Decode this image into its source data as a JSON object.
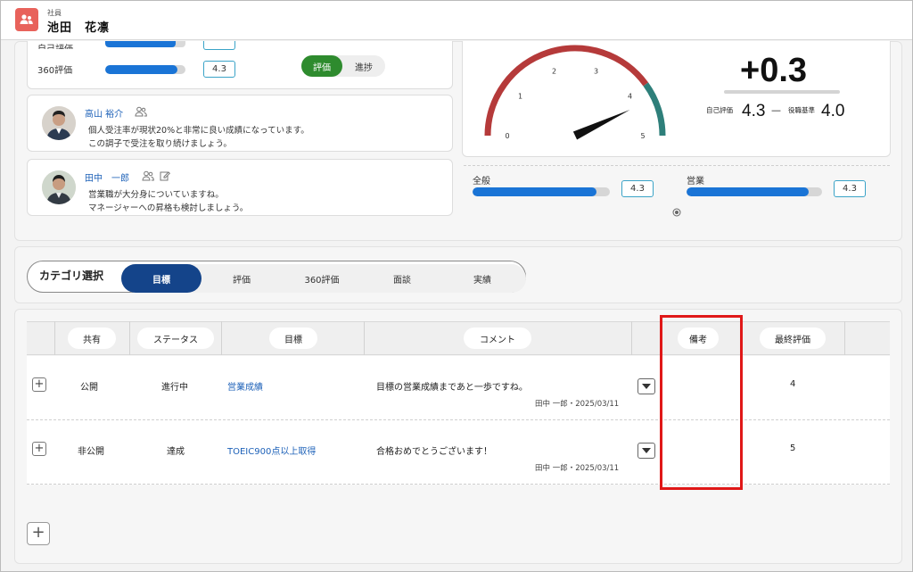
{
  "header": {
    "label": "社員",
    "name": "池田　花凛"
  },
  "scores": {
    "partial_label": "自己評価",
    "row_360_label": "360評価",
    "row_360_value": "4.3",
    "row_360_progress": 0.9,
    "toggle": {
      "active": "評価",
      "inactive": "進捗"
    }
  },
  "comments": [
    {
      "name": "高山 裕介",
      "lines": [
        "個人受注率が現状20%と非常に良い成績になっています。",
        "この調子で受注を取り続けましょう。"
      ]
    },
    {
      "name": "田中　一郎",
      "lines": [
        "営業職が大分身についていますね。",
        "マネージャーへの昇格も検討しましょう。"
      ]
    }
  ],
  "gauge": {
    "ticks": [
      "0",
      "1",
      "2",
      "3",
      "4",
      "5"
    ],
    "value": 4.3,
    "delta": "+0.3",
    "self_label": "自己評価",
    "self_value": "4.3",
    "dash": "—",
    "role_label": "役職基準",
    "role_value": "4.0",
    "colors": {
      "low": "#b53a3a",
      "high": "#2e7f7a"
    }
  },
  "sub_scores": [
    {
      "label": "全般",
      "value": "4.3",
      "progress": 0.9
    },
    {
      "label": "営業",
      "value": "4.3",
      "progress": 0.9
    }
  ],
  "category": {
    "label": "カテゴリ選択",
    "tabs": [
      "目標",
      "評価",
      "360評価",
      "面談",
      "実績"
    ],
    "active": "目標"
  },
  "table": {
    "headers": [
      "共有",
      "ステータス",
      "目標",
      "コメント",
      "備考",
      "最終評価"
    ],
    "rows": [
      {
        "share": "公開",
        "status": "進行中",
        "goal": "営業成績",
        "comment": "目標の営業成績まであと一歩ですね。",
        "meta": "田中 一郎・2025/03/11",
        "note": "",
        "final": "4"
      },
      {
        "share": "非公開",
        "status": "達成",
        "goal": "TOEIC900点以上取得",
        "comment": "合格おめでとうございます！",
        "meta": "田中 一郎・2025/03/11",
        "note": "",
        "final": "5"
      }
    ],
    "expand_symbol": "+",
    "add_symbol": "+"
  }
}
